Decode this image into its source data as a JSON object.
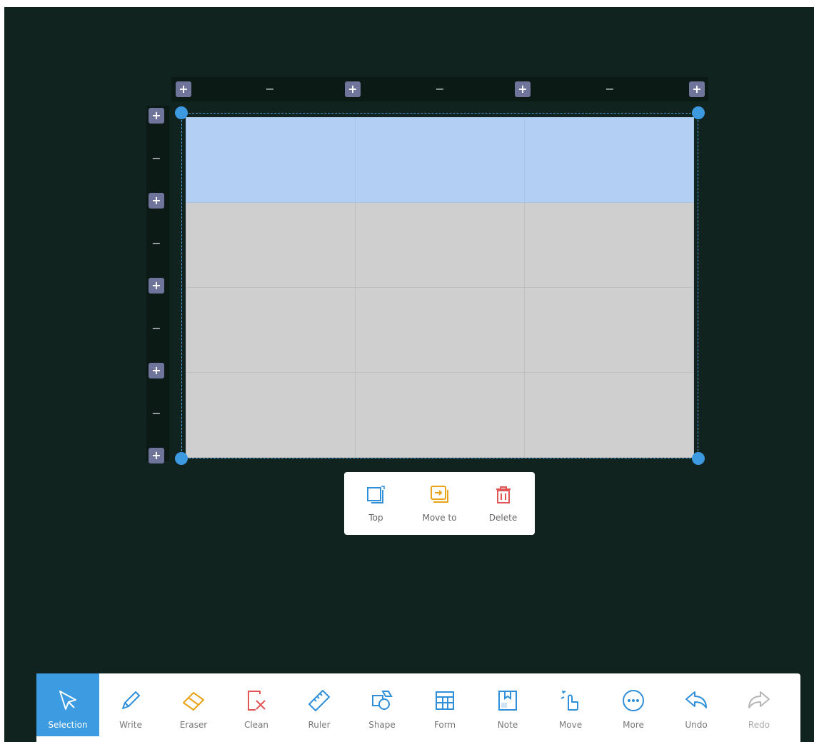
{
  "board": {
    "background": "#11231f",
    "column_controls": [
      "+",
      "−",
      "+",
      "−",
      "+",
      "−",
      "+"
    ],
    "row_controls": [
      "+",
      "−",
      "+",
      "−",
      "+",
      "−",
      "+",
      "−",
      "+"
    ]
  },
  "table": {
    "rows": 4,
    "columns": 3,
    "header_color": "#b3d0f4",
    "cell_color": "#cfcfcf",
    "selection_color": "#3d9ae0"
  },
  "popup": {
    "items": [
      {
        "label": "Top",
        "icon": "bring-to-top-icon",
        "color": "#2f8fd8"
      },
      {
        "label": "Move to",
        "icon": "move-to-icon",
        "color": "#e8a317"
      },
      {
        "label": "Delete",
        "icon": "trash-icon",
        "color": "#e25555"
      }
    ]
  },
  "toolbar": {
    "items": [
      {
        "label": "Selection",
        "icon": "cursor-arrow-icon",
        "active": true
      },
      {
        "label": "Write",
        "icon": "pen-icon"
      },
      {
        "label": "Eraser",
        "icon": "eraser-icon"
      },
      {
        "label": "Clean",
        "icon": "clean-page-icon"
      },
      {
        "label": "Ruler",
        "icon": "ruler-icon"
      },
      {
        "label": "Shape",
        "icon": "shape-icon"
      },
      {
        "label": "Form",
        "icon": "table-icon"
      },
      {
        "label": "Note",
        "icon": "note-icon"
      },
      {
        "label": "Move",
        "icon": "hand-move-icon"
      },
      {
        "label": "More",
        "icon": "more-icon"
      },
      {
        "label": "Undo",
        "icon": "undo-icon"
      },
      {
        "label": "Redo",
        "icon": "redo-icon",
        "disabled": true
      }
    ]
  }
}
